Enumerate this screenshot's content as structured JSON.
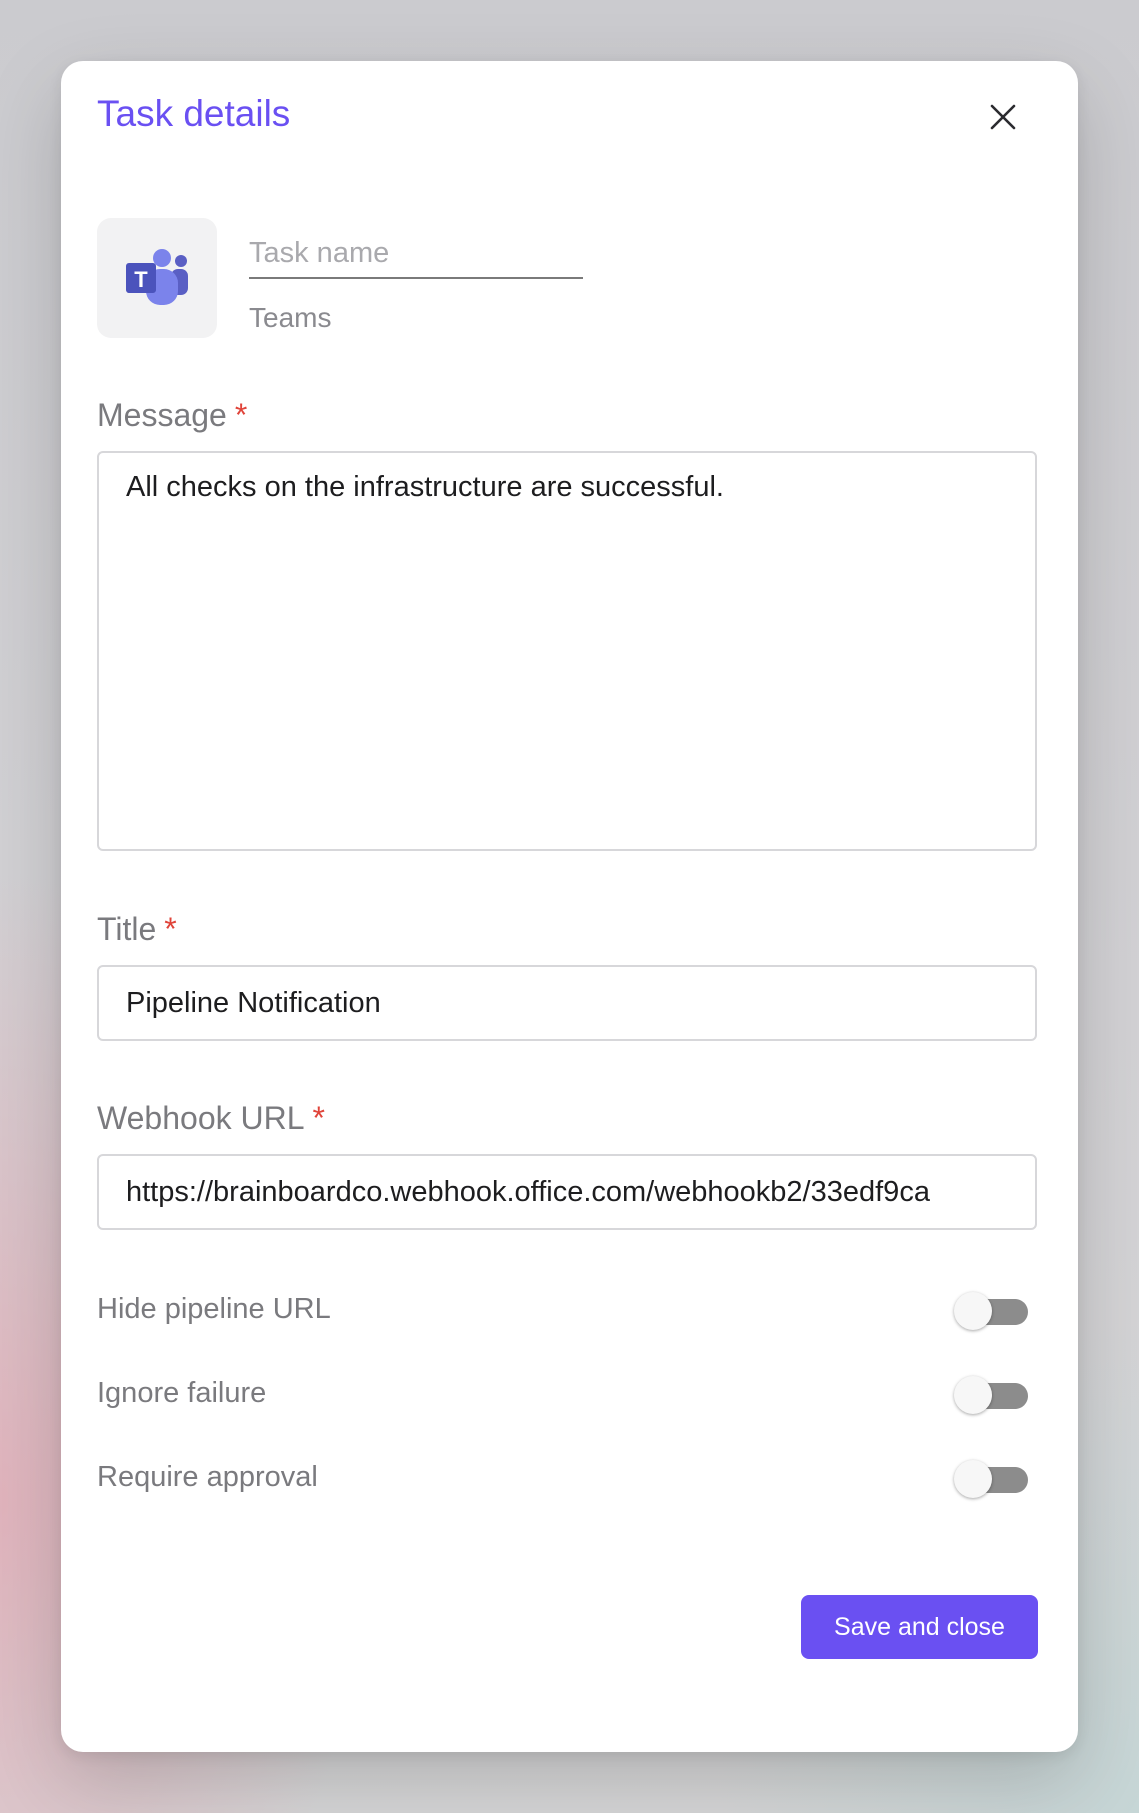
{
  "dialog": {
    "title": "Task details",
    "close_icon": "close-icon"
  },
  "task": {
    "logo_icon": "microsoft-teams-icon",
    "name_placeholder": "Task name",
    "name_value": "",
    "type": "Teams"
  },
  "fields": {
    "message": {
      "label": "Message",
      "required_mark": "*",
      "value": "All checks on the infrastructure are successful."
    },
    "title": {
      "label": "Title",
      "required_mark": "*",
      "value": "Pipeline Notification"
    },
    "webhook": {
      "label": "Webhook URL",
      "required_mark": "*",
      "value": "https://brainboardco.webhook.office.com/webhookb2/33edf9ca"
    }
  },
  "toggles": [
    {
      "label": "Hide pipeline URL",
      "on": false
    },
    {
      "label": "Ignore failure",
      "on": false
    },
    {
      "label": "Require approval",
      "on": false
    }
  ],
  "actions": {
    "save_label": "Save and close"
  },
  "colors": {
    "accent": "#6a50f2",
    "required": "#e0443a",
    "toggle_off_track": "#8c8c8c"
  }
}
